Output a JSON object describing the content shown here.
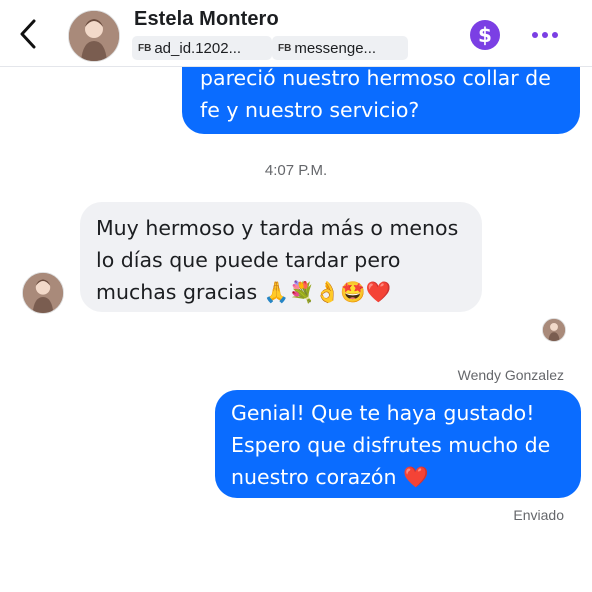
{
  "header": {
    "contact_name": "Estela Montero",
    "tags": [
      {
        "prefix": "FB",
        "label": "ad_id.1202..."
      },
      {
        "prefix": "FB",
        "label": "messenge..."
      }
    ],
    "payment_symbol": "$",
    "icons": {
      "back": "back-arrow-icon",
      "payment": "dollar-icon",
      "more": "more-options-icon"
    }
  },
  "messages": {
    "outgoing_1": {
      "line1": "pareció nuestro hermoso collar de",
      "line2": "fe y nuestro servicio?"
    },
    "timestamp": "4:07 P.M.",
    "incoming_1": {
      "line1": "Muy hermoso y tarda más o menos",
      "line2": "lo días que puede tardar pero",
      "line3_text": "muchas gracias ",
      "line3_emojis": "🙏💐👌🤩",
      "line3_heart": "❤️"
    },
    "sender_label": "Wendy Gonzalez",
    "outgoing_2": {
      "line1": "Genial! Que te haya gustado!",
      "line2": "Espero que disfrutes mucho de",
      "line3_text": "nuestro corazón ",
      "line3_heart": "❤️"
    },
    "status": "Enviado"
  },
  "colors": {
    "outgoing_bubble": "#0a6cff",
    "incoming_bubble": "#f0f1f4",
    "accent": "#7b3fe4",
    "meta_text": "#65676b"
  }
}
